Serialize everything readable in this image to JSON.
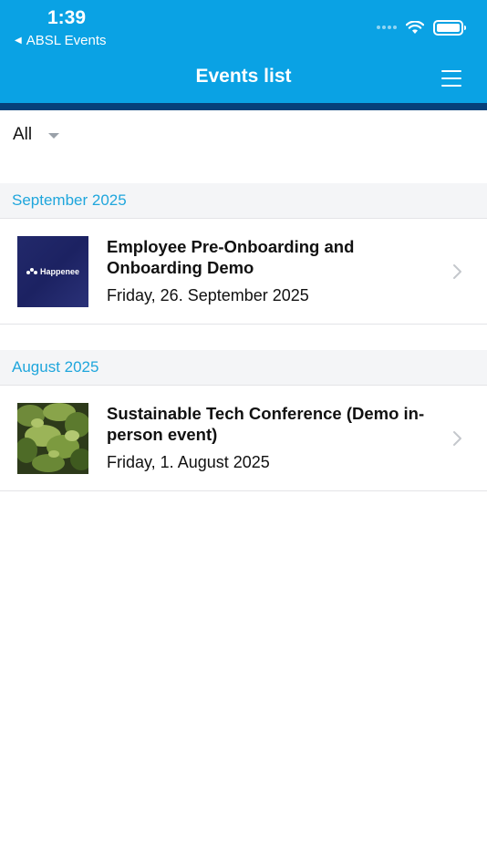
{
  "status_bar": {
    "time": "1:39",
    "back_app": "ABSL Events",
    "back_caret": "◀"
  },
  "header": {
    "title": "Events list",
    "menu_icon": "hamburger-menu-icon",
    "color_primary": "#0AA2E4",
    "color_strip": "#06407A"
  },
  "filter": {
    "value": "All",
    "icon": "dropdown-caret-icon"
  },
  "sections": [
    {
      "label": "September 2025",
      "events": [
        {
          "title": "Employee Pre-Onboarding and Onboarding Demo",
          "date": "Friday, 26. September 2025",
          "thumb_text": "Happenee",
          "thumb_icon": "happenee-logo-icon"
        }
      ]
    },
    {
      "label": "August 2025",
      "events": [
        {
          "title": "Sustainable Tech Conference (Demo in-person event)",
          "date": "Friday, 1. August 2025",
          "thumb_icon": "foliage-photo"
        }
      ]
    }
  ],
  "accent_color": "#1FA6DC"
}
